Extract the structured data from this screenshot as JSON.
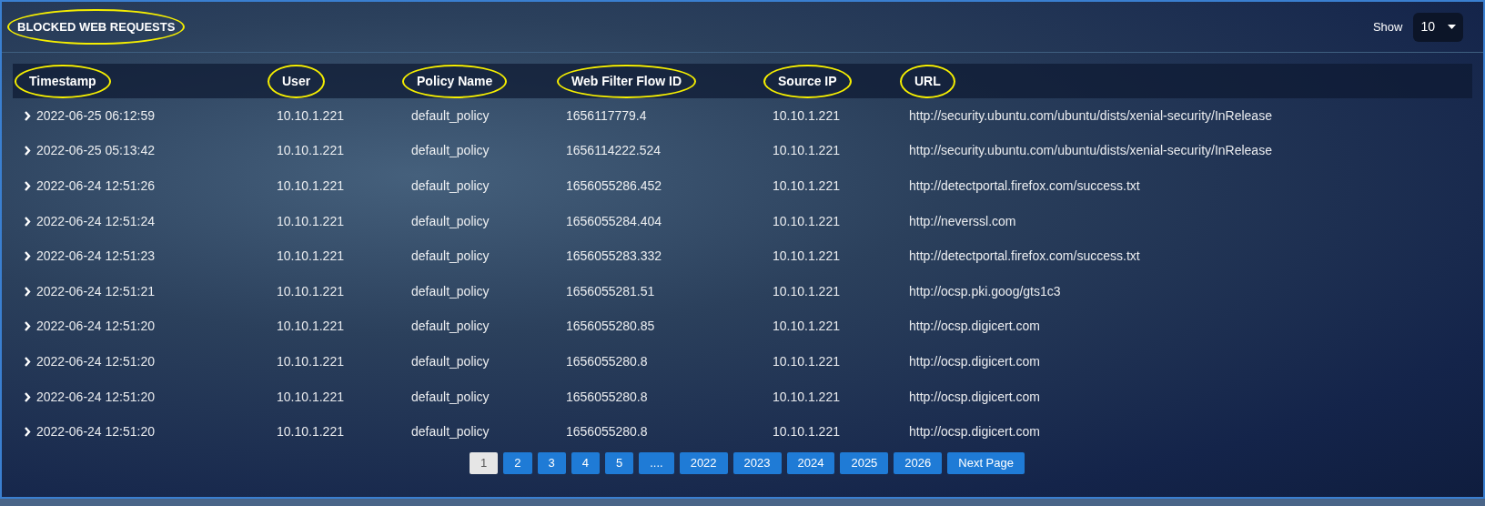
{
  "panel": {
    "title": "BLOCKED WEB REQUESTS",
    "title_circled": true,
    "show_label": "Show",
    "show_value": "10"
  },
  "table": {
    "columns": [
      {
        "label": "Timestamp",
        "circled": true
      },
      {
        "label": "User",
        "circled": true
      },
      {
        "label": "Policy Name",
        "circled": true
      },
      {
        "label": "Web Filter Flow ID",
        "circled": true
      },
      {
        "label": "Source IP",
        "circled": true
      },
      {
        "label": "URL",
        "circled": true
      }
    ],
    "rows": [
      {
        "expanded": false,
        "cells": [
          "2022-06-25 06:12:59",
          "10.10.1.221",
          "default_policy",
          "1656117779.4",
          "10.10.1.221",
          "http://security.ubuntu.com/ubuntu/dists/xenial-security/InRelease"
        ]
      },
      {
        "expanded": false,
        "cells": [
          "2022-06-25 05:13:42",
          "10.10.1.221",
          "default_policy",
          "1656114222.524",
          "10.10.1.221",
          "http://security.ubuntu.com/ubuntu/dists/xenial-security/InRelease"
        ]
      },
      {
        "expanded": false,
        "cells": [
          "2022-06-24 12:51:26",
          "10.10.1.221",
          "default_policy",
          "1656055286.452",
          "10.10.1.221",
          "http://detectportal.firefox.com/success.txt"
        ]
      },
      {
        "expanded": false,
        "cells": [
          "2022-06-24 12:51:24",
          "10.10.1.221",
          "default_policy",
          "1656055284.404",
          "10.10.1.221",
          "http://neverssl.com"
        ]
      },
      {
        "expanded": false,
        "cells": [
          "2022-06-24 12:51:23",
          "10.10.1.221",
          "default_policy",
          "1656055283.332",
          "10.10.1.221",
          "http://detectportal.firefox.com/success.txt"
        ]
      },
      {
        "expanded": false,
        "cells": [
          "2022-06-24 12:51:21",
          "10.10.1.221",
          "default_policy",
          "1656055281.51",
          "10.10.1.221",
          "http://ocsp.pki.goog/gts1c3"
        ]
      },
      {
        "expanded": false,
        "cells": [
          "2022-06-24 12:51:20",
          "10.10.1.221",
          "default_policy",
          "1656055280.85",
          "10.10.1.221",
          "http://ocsp.digicert.com"
        ]
      },
      {
        "expanded": false,
        "cells": [
          "2022-06-24 12:51:20",
          "10.10.1.221",
          "default_policy",
          "1656055280.8",
          "10.10.1.221",
          "http://ocsp.digicert.com"
        ]
      },
      {
        "expanded": false,
        "cells": [
          "2022-06-24 12:51:20",
          "10.10.1.221",
          "default_policy",
          "1656055280.8",
          "10.10.1.221",
          "http://ocsp.digicert.com"
        ]
      },
      {
        "expanded": false,
        "cells": [
          "2022-06-24 12:51:20",
          "10.10.1.221",
          "default_policy",
          "1656055280.8",
          "10.10.1.221",
          "http://ocsp.digicert.com"
        ]
      }
    ]
  },
  "pagination": [
    {
      "label": "1",
      "selected": true
    },
    {
      "label": "2",
      "selected": false
    },
    {
      "label": "3",
      "selected": false
    },
    {
      "label": "4",
      "selected": false
    },
    {
      "label": "5",
      "selected": false
    },
    {
      "label": "....",
      "selected": false
    },
    {
      "label": "2022",
      "selected": false
    },
    {
      "label": "2023",
      "selected": false
    },
    {
      "label": "2024",
      "selected": false
    },
    {
      "label": "2025",
      "selected": false
    },
    {
      "label": "2026",
      "selected": false
    },
    {
      "label": "Next Page",
      "selected": false
    }
  ]
}
